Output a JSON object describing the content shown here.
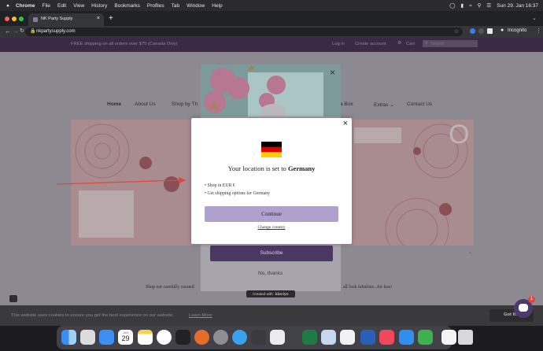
{
  "menubar": {
    "apple": "",
    "items": [
      "Chrome",
      "File",
      "Edit",
      "View",
      "History",
      "Bookmarks",
      "Profiles",
      "Tab",
      "Window",
      "Help"
    ],
    "clock": "Sun 29. Jan  16:37"
  },
  "browser": {
    "tab_title": "NK Party Supply",
    "new_tab": "+",
    "close_tab": "×",
    "url": "nkpartysupply.com",
    "profile": "Incognito"
  },
  "site": {
    "promo": "FREE shipping on all orders over $75 (Canada Only)",
    "login": "Log in",
    "create_account": "Create account",
    "cart": "Cart",
    "search_placeholder": "Search",
    "nav": [
      "Home",
      "About Us",
      "Shop by Th",
      "a Box",
      "Extras ⌄",
      "Contact Us"
    ],
    "tagline_left": "Shop our carefully curated",
    "tagline_right": "all look fabulous...for less!",
    "cookie_text": "This website uses cookies to ensure you get the best experience on our website.",
    "cookie_link": "Learn More",
    "cookie_button": "Got It!"
  },
  "klaviyo": {
    "subscribe": "Subscribe",
    "no_thanks": "No, thanks",
    "badge_prefix": "Created with",
    "badge_brand": "klaviyo"
  },
  "modal": {
    "close": "×",
    "title_prefix": "Your location is set to ",
    "country": "Germany",
    "bullets": [
      "Shop in EUR €",
      "Get shipping options for Germany"
    ],
    "continue": "Continue",
    "change_country": "Change country"
  },
  "chat_badge": "1",
  "dock": {
    "calendar_month": "JAN",
    "calendar_day": "29"
  },
  "colors": {
    "accent_purple": "#b0a0cd",
    "subscribe_purple": "#4a3863",
    "flag_black": "#000000",
    "flag_red": "#dd0000",
    "flag_gold": "#ffce00",
    "annotation_arrow": "#e0463c"
  }
}
